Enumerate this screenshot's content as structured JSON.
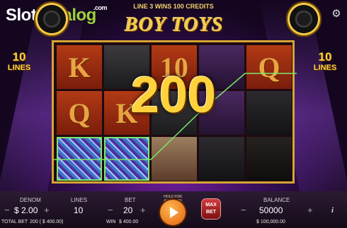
{
  "watermark": {
    "slot": "Slot",
    "catalog": "Catalog",
    "com": ".com"
  },
  "header": {
    "line_message": "LINE 3 WINS 100 CREDITS",
    "logo": "BOY TOYS"
  },
  "side_tags": {
    "left": {
      "number": "10",
      "word": "LINES"
    },
    "right": {
      "number": "10",
      "word": "LINES"
    }
  },
  "icons": {
    "settings": "gear-icon",
    "spin": "play-icon",
    "info": "info-icon"
  },
  "reels": {
    "rows": [
      [
        {
          "type": "letter",
          "label": "K"
        },
        {
          "type": "dark",
          "label": ""
        },
        {
          "type": "letter",
          "label": "10"
        },
        {
          "type": "purple",
          "label": ""
        },
        {
          "type": "letter",
          "label": "Q"
        }
      ],
      [
        {
          "type": "letter",
          "label": "Q"
        },
        {
          "type": "letter",
          "label": "K"
        },
        {
          "type": "dark",
          "label": ""
        },
        {
          "type": "purple",
          "label": ""
        },
        {
          "type": "boat",
          "label": ""
        }
      ],
      [
        {
          "type": "disco",
          "label": ""
        },
        {
          "type": "disco",
          "label": ""
        },
        {
          "type": "girl",
          "label": ""
        },
        {
          "type": "boat",
          "label": ""
        },
        {
          "type": "bottle",
          "label": ""
        }
      ]
    ],
    "highlighted": [
      [
        2,
        0
      ],
      [
        2,
        1
      ]
    ],
    "win_amount": "200",
    "payline_color": "#7ae86a"
  },
  "footer": {
    "denom": {
      "label": "DENOM",
      "value": "$ 2.00",
      "minus": "−",
      "plus": "+"
    },
    "lines": {
      "label": "LINES",
      "value": "10"
    },
    "bet": {
      "label": "BET",
      "value": "20",
      "minus": "−",
      "plus": "+"
    },
    "hold_text": "HOLD FOR AUTOSPIN",
    "max_bet": {
      "line1": "MAX",
      "line2": "BET"
    },
    "balance": {
      "label": "BALANCE",
      "value": "50000",
      "minus": "−",
      "plus": "+"
    },
    "total_bet": {
      "label": "TOTAL BET",
      "value": "200 ( $ 400.00)"
    },
    "win": {
      "label": "WIN",
      "value": "$ 400.00"
    },
    "balance_money": "$ 100,000.00",
    "info": "i"
  },
  "colors": {
    "gold": "#ffd13a",
    "accent_orange": "#e0620f",
    "win_green": "#7ae86a"
  }
}
